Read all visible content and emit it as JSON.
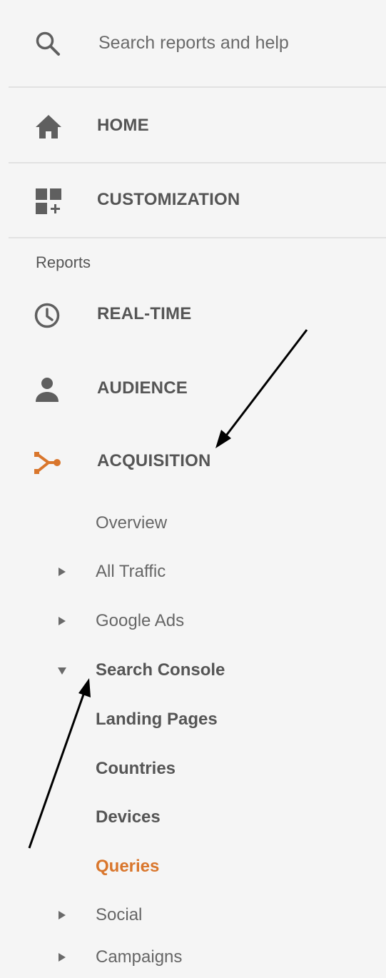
{
  "search": {
    "placeholder": "Search reports and help",
    "icon": "search-icon"
  },
  "nav": {
    "home": {
      "label": "HOME",
      "icon": "home-icon"
    },
    "customization": {
      "label": "CUSTOMIZATION",
      "icon": "dashboard-add-icon"
    }
  },
  "reports": {
    "section_label": "Reports",
    "items": [
      {
        "label": "REAL-TIME",
        "icon": "clock-icon"
      },
      {
        "label": "AUDIENCE",
        "icon": "person-icon"
      },
      {
        "label": "ACQUISITION",
        "icon": "acquisition-icon",
        "active": true
      }
    ]
  },
  "acquisition": {
    "overview": "Overview",
    "all_traffic": "All Traffic",
    "google_ads": "Google Ads",
    "search_console": "Search Console",
    "search_console_children": [
      "Landing Pages",
      "Countries",
      "Devices",
      "Queries"
    ],
    "selected": "Queries",
    "social": "Social",
    "campaigns": "Campaigns"
  },
  "colors": {
    "background": "#f5f5f5",
    "text": "#555555",
    "muted_text": "#666666",
    "accent": "#d9762c",
    "icon": "#5f5f5f",
    "divider": "#e2e2e2",
    "arrow": "#000000"
  }
}
